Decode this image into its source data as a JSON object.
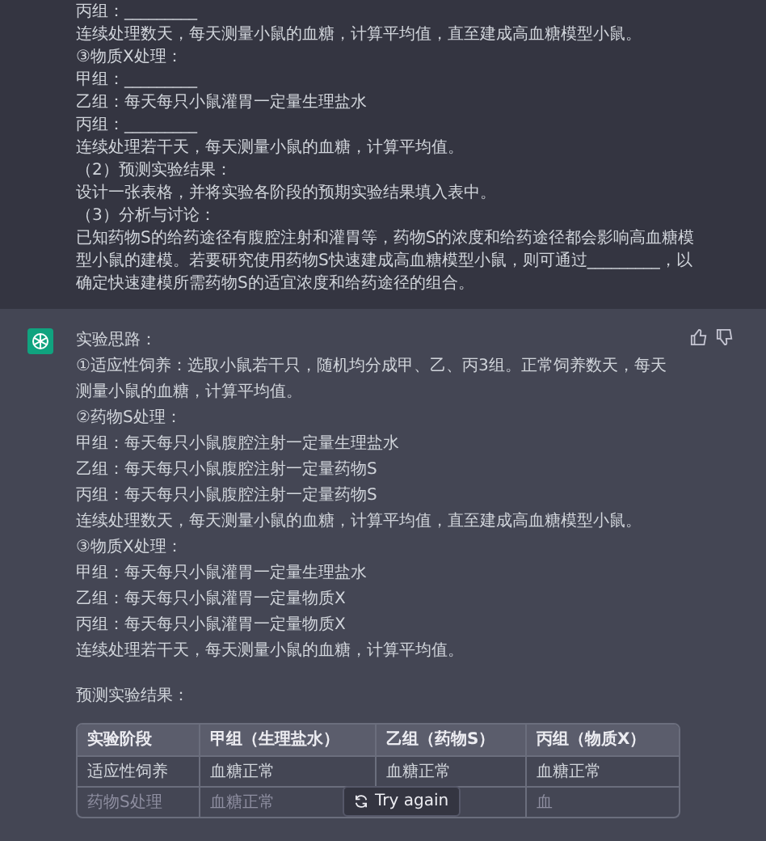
{
  "question": {
    "lines": [
      "丙组：_________",
      "连续处理数天，每天测量小鼠的血糖，计算平均值，直至建成高血糖模型小鼠。",
      "③物质X处理：",
      "甲组：_________",
      "乙组：每天每只小鼠灌胃一定量生理盐水",
      "丙组：_________",
      "连续处理若干天，每天测量小鼠的血糖，计算平均值。",
      "（2）预测实验结果：",
      "设计一张表格，并将实验各阶段的预期实验结果填入表中。",
      "（3）分析与讨论：",
      "已知药物S的给药途径有腹腔注射和灌胃等，药物S的浓度和给药途径都会影响高血糖模型小鼠的建模。若要研究使用药物S快速建成高血糖模型小鼠，则可通过_________，以确定快速建模所需药物S的适宜浓度和给药途径的组合。"
    ]
  },
  "answer": {
    "lines": [
      "实验思路：",
      "①适应性饲养：选取小鼠若干只，随机均分成甲、乙、丙3组。正常饲养数天，每天测量小鼠的血糖，计算平均值。",
      "②药物S处理：",
      "甲组：每天每只小鼠腹腔注射一定量生理盐水",
      "乙组：每天每只小鼠腹腔注射一定量药物S",
      "丙组：每天每只小鼠腹腔注射一定量药物S",
      "连续处理数天，每天测量小鼠的血糖，计算平均值，直至建成高血糖模型小鼠。",
      "③物质X处理：",
      "甲组：每天每只小鼠灌胃一定量生理盐水",
      "乙组：每天每只小鼠灌胃一定量物质X",
      "丙组：每天每只小鼠灌胃一定量物质X",
      "连续处理若干天，每天测量小鼠的血糖，计算平均值。"
    ],
    "subheading": "预测实验结果：",
    "table": {
      "columns": [
        "实验阶段",
        "甲组（生理盐水）",
        "乙组（药物S）",
        "丙组（物质X）"
      ],
      "rows": [
        [
          "适应性饲养",
          "血糖正常",
          "血糖正常",
          "血糖正常"
        ],
        [
          "药物S处理",
          "血糖正常",
          null,
          "血"
        ]
      ]
    }
  },
  "try_again_button": {
    "label": "Try again"
  }
}
